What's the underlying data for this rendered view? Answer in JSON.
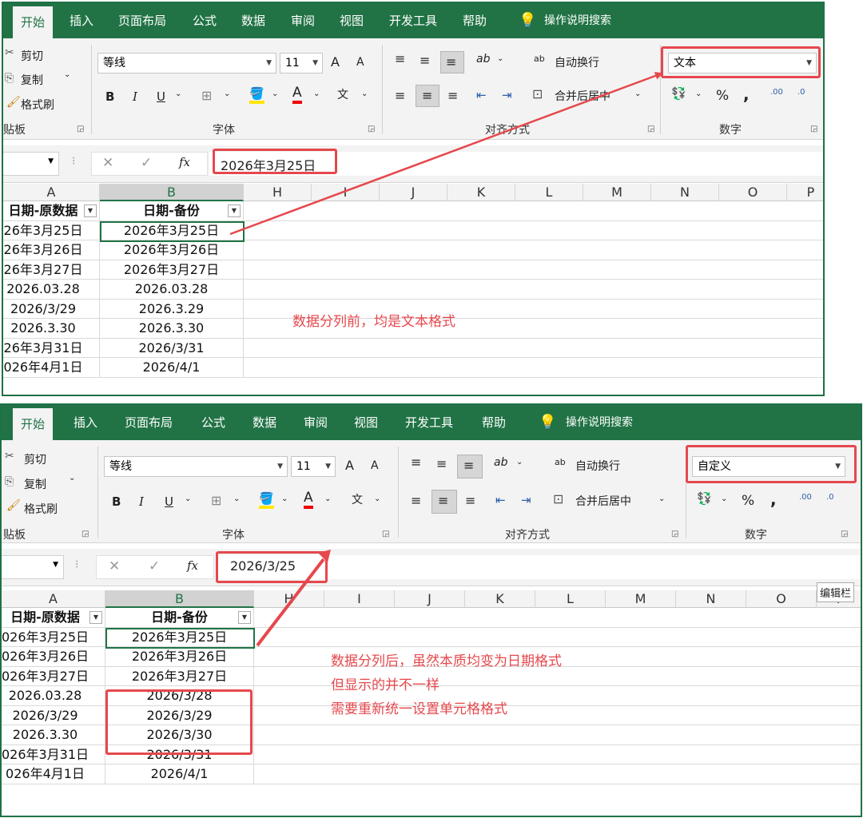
{
  "tabs": [
    "开始",
    "插入",
    "页面布局",
    "公式",
    "数据",
    "审阅",
    "视图",
    "开发工具",
    "帮助"
  ],
  "tell_me": "操作说明搜索",
  "clipboard": {
    "cut": "剪切",
    "copy": "复制",
    "painter": "格式刷",
    "label": "贴板"
  },
  "font": {
    "name": "等线",
    "size": "11",
    "label": "字体",
    "bold": "B",
    "italic": "I",
    "underline": "U",
    "grow": "A",
    "shrink": "A",
    "color_a": "A",
    "phonetic": "文"
  },
  "align": {
    "wrap": "自动换行",
    "merge": "合并后居中",
    "label": "对齐方式",
    "wrap_icon": "ab",
    "angle": "ab"
  },
  "number": {
    "label": "数字",
    "percent": "%",
    "comma": ",",
    "inc": ".00",
    "dec": ".0"
  },
  "formula": {
    "cancel": "✕",
    "enter": "✓",
    "fx": "fx"
  },
  "columns": [
    "A",
    "B",
    "H",
    "I",
    "J",
    "K",
    "L",
    "M",
    "N",
    "O",
    "P"
  ],
  "header": {
    "a": "日期-原数据",
    "b": "日期-备份"
  },
  "panel1": {
    "number_format": "文本",
    "formula_value": "2026年3月25日",
    "rows": [
      [
        "26年3月25日",
        "2026年3月25日"
      ],
      [
        "26年3月26日",
        "2026年3月26日"
      ],
      [
        "26年3月27日",
        "2026年3月27日"
      ],
      [
        "2026.03.28",
        "2026.03.28"
      ],
      [
        "2026/3/29",
        "2026.3.29"
      ],
      [
        "2026.3.30",
        "2026.3.30"
      ],
      [
        "26年3月31日",
        "2026/3/31"
      ],
      [
        "026年4月1日",
        "2026/4/1"
      ]
    ],
    "note": "数据分列前，均是文本格式"
  },
  "panel2": {
    "number_format": "自定义",
    "formula_value": "2026/3/25",
    "formula_tooltip": "编辑栏",
    "rows": [
      [
        "026年3月25日",
        "2026年3月25日"
      ],
      [
        "026年3月26日",
        "2026年3月26日"
      ],
      [
        "026年3月27日",
        "2026年3月27日"
      ],
      [
        "2026.03.28",
        "2026/3/28"
      ],
      [
        "2026/3/29",
        "2026/3/29"
      ],
      [
        "2026.3.30",
        "2026/3/30"
      ],
      [
        "026年3月31日",
        "2026/3/31"
      ],
      [
        "026年4月1日",
        "2026/4/1"
      ]
    ],
    "note_lines": [
      "数据分列后，虽然本质均变为日期格式",
      "但显示的并不一样",
      "需要重新统一设置单元格格式"
    ]
  },
  "colors": {
    "excel_green": "#217346",
    "highlight_red": "#e5484d"
  }
}
